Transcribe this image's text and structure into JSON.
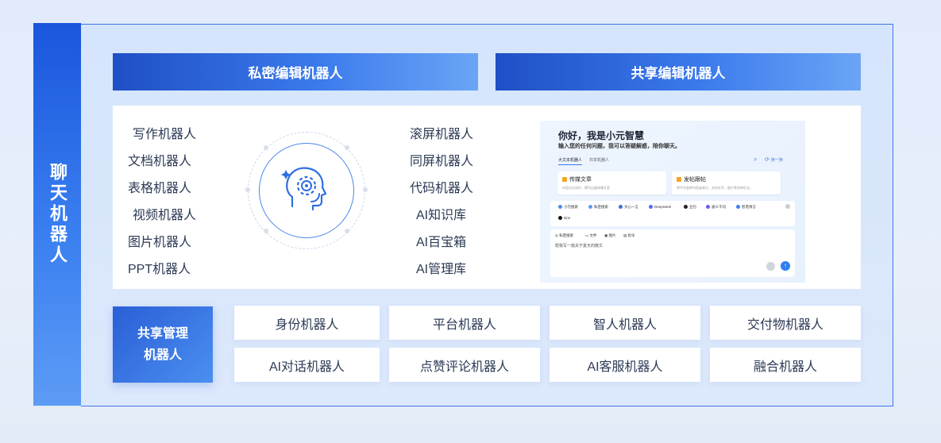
{
  "side_title": "聊天机器人",
  "header_left": "私密编辑机器人",
  "header_right": "共享编辑机器人",
  "left_robots": [
    "写作机器人",
    "文档机器人",
    "表格机器人",
    "视频机器人",
    "图片机器人",
    "PPT机器人"
  ],
  "right_robots": [
    "滚屏机器人",
    "同屏机器人",
    "代码机器人",
    "AI知识库",
    "AI百宝箱",
    "AI管理库"
  ],
  "hub_icon": "brain-gear-icon",
  "screenshot": {
    "greeting": "你好，我是小元智慧",
    "subtitle": "输入您的任何问题，我可以答疑解惑，陪你聊天。",
    "tabs": [
      "大文本机器人",
      "共享机器人"
    ],
    "refresh_label": "换一换",
    "cards": [
      {
        "title": "传媒文章",
        "desc": "内容自主创作，撰写自媒体爆文案"
      },
      {
        "title": "发帖跟帖",
        "desc": "将平台各种内容或观点，支持文字、图片等多种形式。"
      }
    ],
    "models": [
      "小元搜索",
      "私密搜索",
      "文心一言",
      "DeepSeek",
      "豆包",
      "通义千问",
      "智谱清言",
      "kimi"
    ],
    "input_tools": [
      "私密搜索",
      "文件",
      "图片",
      "指令"
    ],
    "input_placeholder": "帮我写一篇关于夏天的散文",
    "accent_color": "#2d7ff0"
  },
  "manager_title_line1": "共享管理",
  "manager_title_line2": "机器人",
  "bottom_robots": [
    "身份机器人",
    "平台机器人",
    "智人机器人",
    "交付物机器人",
    "AI对话机器人",
    "点赞评论机器人",
    "AI客服机器人",
    "融合机器人"
  ],
  "colors": {
    "primary_blue": "#1f4fc6",
    "light_blue": "#6aa5f6",
    "frame_border": "#3f78e6",
    "text": "#2c3a55"
  }
}
